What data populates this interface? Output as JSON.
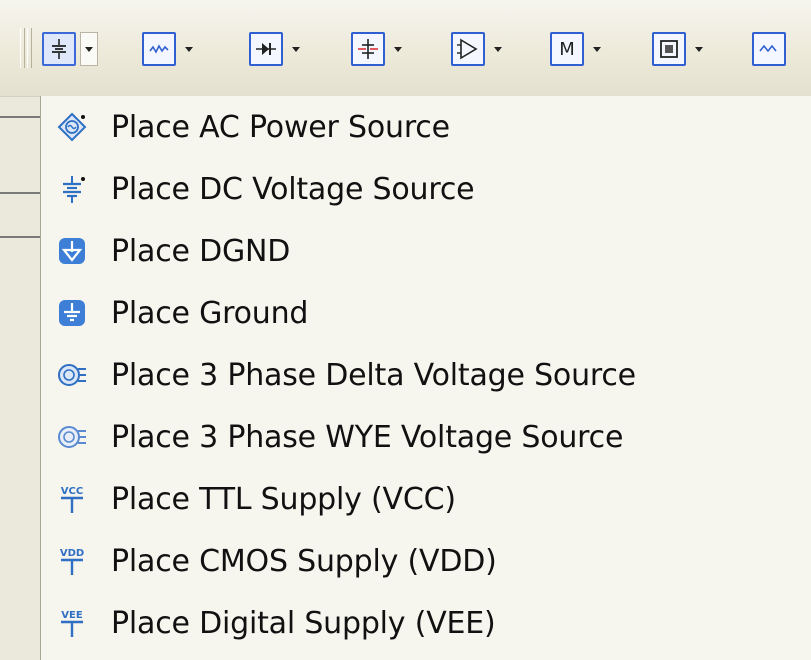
{
  "toolbar": {
    "buttons": [
      {
        "icon": "dc-source-icon",
        "active": true
      },
      {
        "icon": "waveform-icon"
      },
      {
        "icon": "diode-icon"
      },
      {
        "icon": "transistor-icon"
      },
      {
        "icon": "opamp-icon"
      },
      {
        "icon": "misc-m-icon",
        "text": "M"
      },
      {
        "icon": "indicator-icon"
      },
      {
        "icon": "analog-signal-icon"
      }
    ]
  },
  "menu": {
    "items": [
      {
        "label": "Place AC Power Source",
        "icon": "ac-power-source-icon"
      },
      {
        "label": "Place DC Voltage Source",
        "icon": "dc-voltage-source-icon"
      },
      {
        "label": "Place DGND",
        "icon": "dgnd-icon"
      },
      {
        "label": "Place Ground",
        "icon": "ground-icon"
      },
      {
        "label": "Place 3 Phase Delta Voltage Source",
        "icon": "three-phase-delta-icon"
      },
      {
        "label": "Place 3 Phase WYE Voltage Source",
        "icon": "three-phase-wye-icon"
      },
      {
        "label": "Place TTL Supply (VCC)",
        "icon": "vcc-supply-icon",
        "tag": "VCC"
      },
      {
        "label": "Place CMOS Supply (VDD)",
        "icon": "vdd-supply-icon",
        "tag": "VDD"
      },
      {
        "label": "Place Digital Supply (VEE)",
        "icon": "vee-supply-icon",
        "tag": "VEE"
      }
    ]
  },
  "colors": {
    "accent": "#2f5fd0",
    "menu_bg": "#f6f5ee",
    "toolbar_bg": "#ece9d8"
  }
}
